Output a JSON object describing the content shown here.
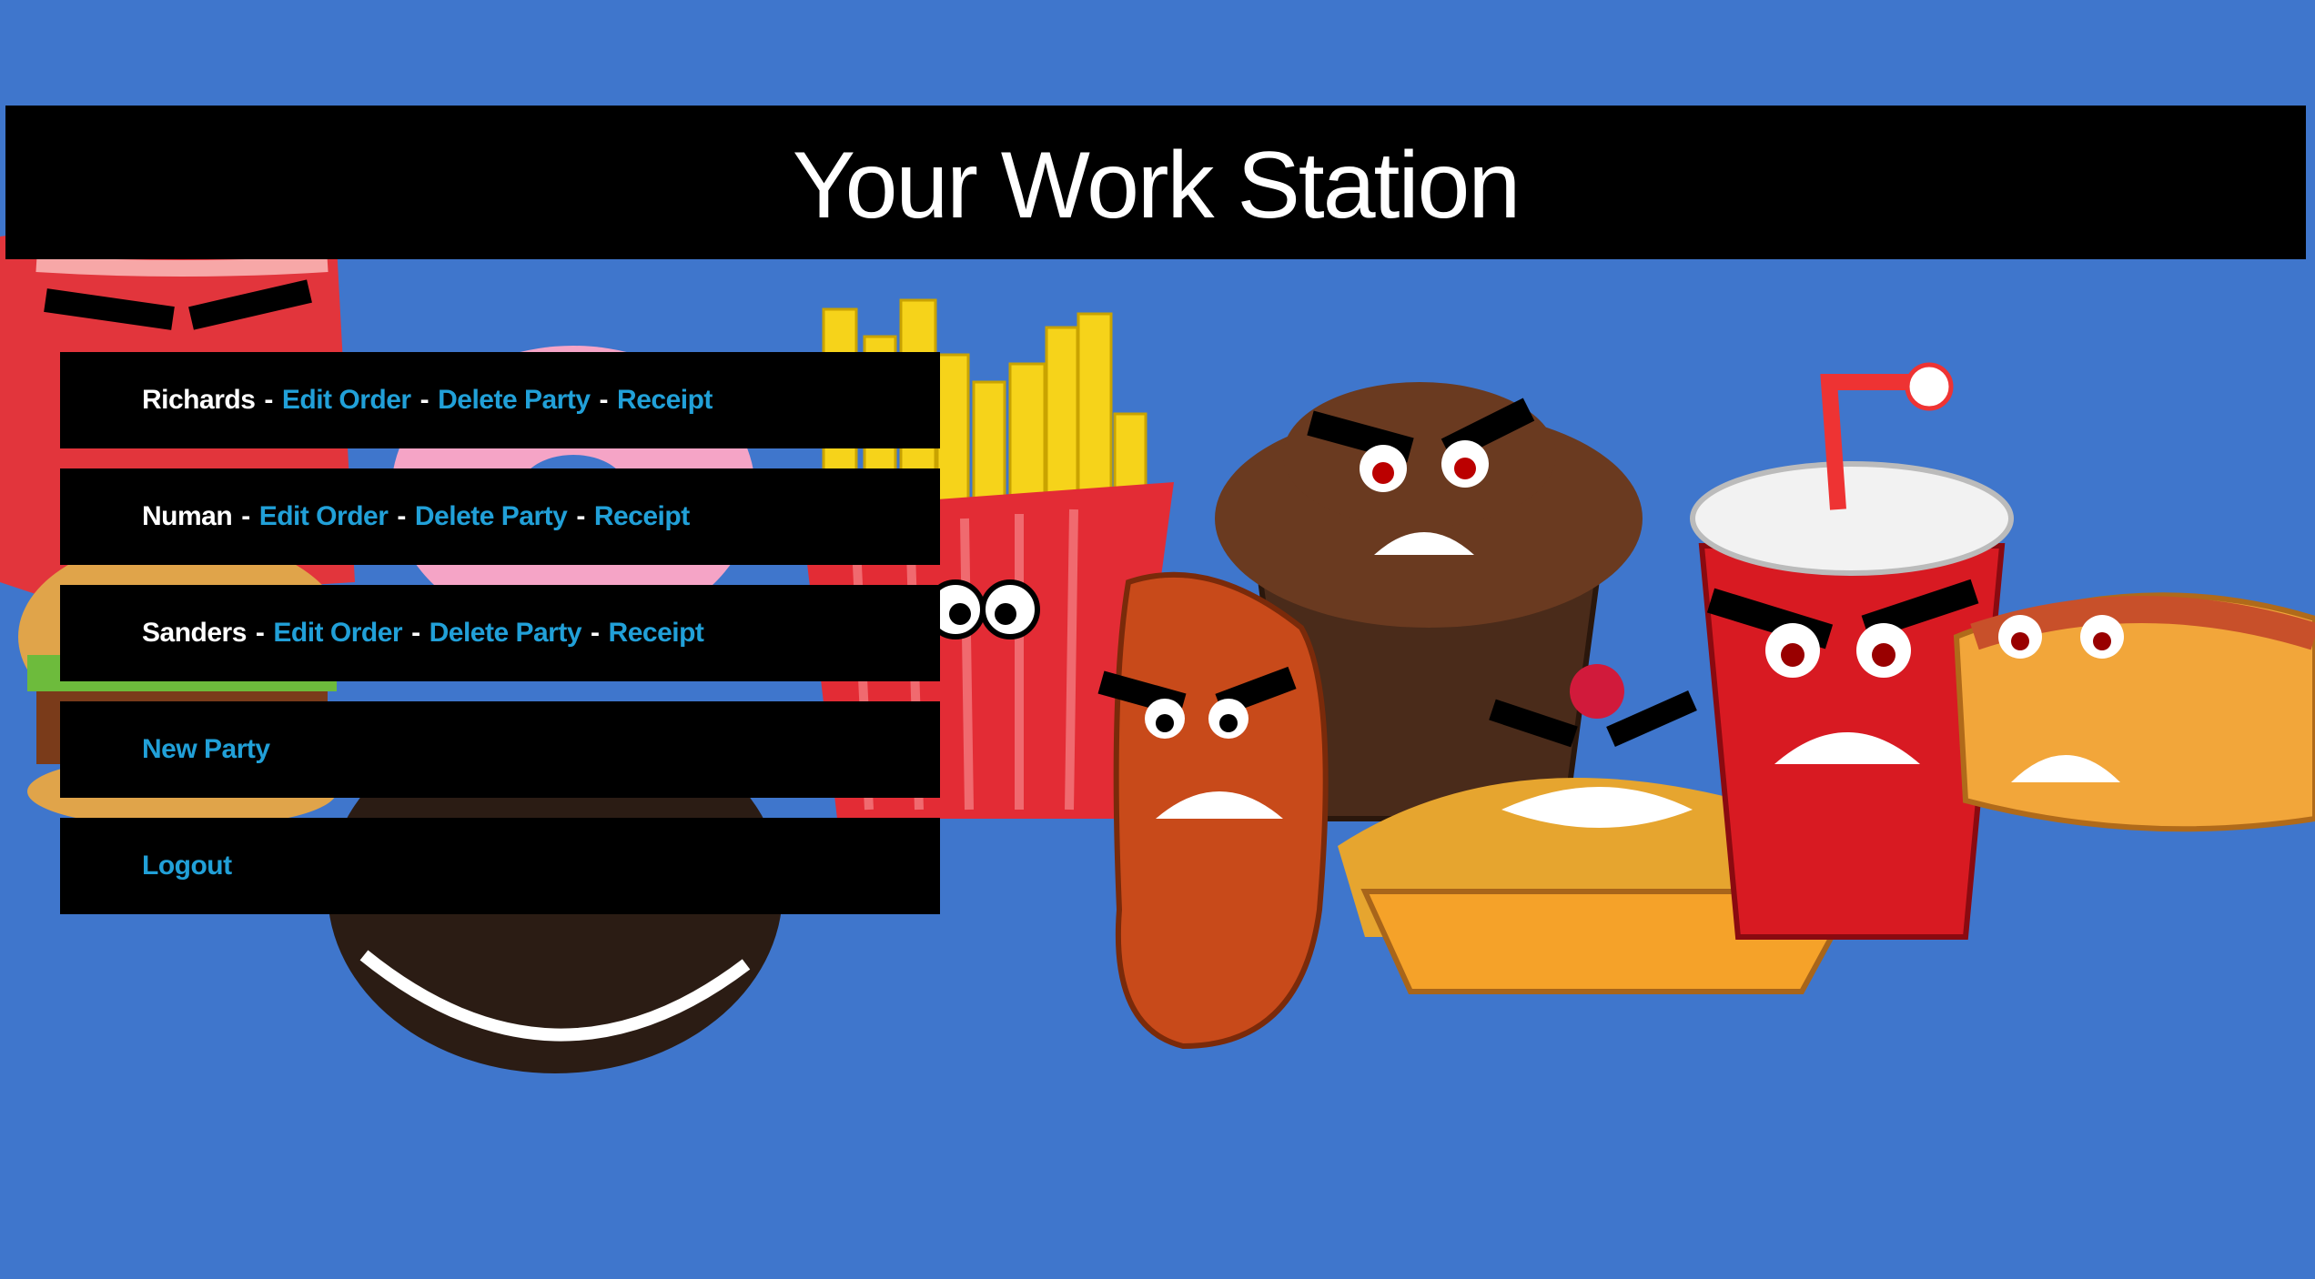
{
  "header": {
    "title": "Your Work Station"
  },
  "parties": [
    {
      "name": "Richards",
      "edit_label": "Edit Order",
      "delete_label": "Delete Party",
      "receipt_label": "Receipt"
    },
    {
      "name": "Numan",
      "edit_label": "Edit Order",
      "delete_label": "Delete Party",
      "receipt_label": "Receipt"
    },
    {
      "name": "Sanders",
      "edit_label": "Edit Order",
      "delete_label": "Delete Party",
      "receipt_label": "Receipt"
    }
  ],
  "separator": "-",
  "actions": {
    "new_party_label": "New Party",
    "logout_label": "Logout"
  },
  "colors": {
    "background": "#3f76cc",
    "bar": "#000000",
    "link": "#21a0d8",
    "text": "#ffffff"
  },
  "background_image": "angry cartoon junk food characters"
}
